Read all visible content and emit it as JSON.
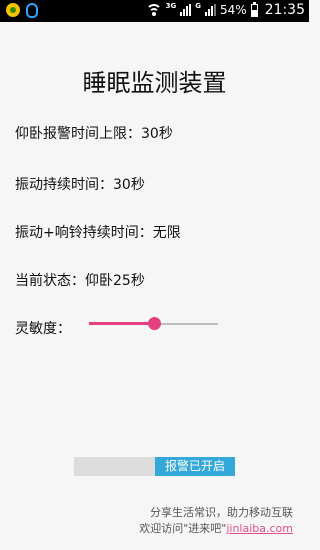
{
  "statusbar": {
    "network_type_1": "3G",
    "network_type_2": "G",
    "battery": "54%",
    "time": "21:35"
  },
  "page": {
    "title": "睡眠监测装置"
  },
  "info": {
    "supine_alarm_limit": "仰卧报警时间上限：30秒",
    "vibration_duration": "振动持续时间：30秒",
    "vibration_ring_duration": "振动+响铃持续时间：无限",
    "current_state": "当前状态：仰卧25秒",
    "sensitivity_label": "灵敏度："
  },
  "sensitivity": {
    "value_fraction": 0.5,
    "accent_color": "#e5407f"
  },
  "alarm_toggle": {
    "label": "报警已开启",
    "on_color": "#34a8d8",
    "state": "on"
  },
  "footer": {
    "line1": "分享生活常识，助力移动互联",
    "line2_prefix": "欢迎访问\"进来吧\"",
    "site": "jinlaiba.com"
  },
  "icons": [
    "app-notification-icon",
    "qq-icon",
    "wifi-icon",
    "signal-icon",
    "battery-icon"
  ]
}
